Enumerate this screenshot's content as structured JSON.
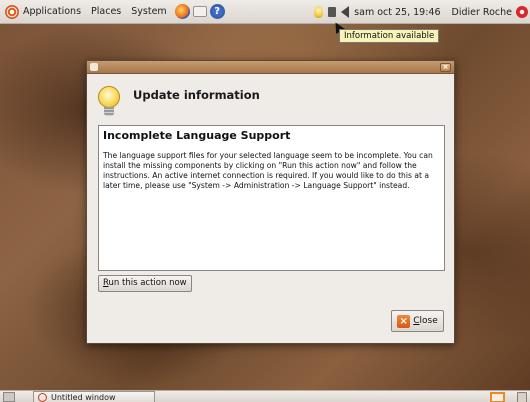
{
  "top_panel": {
    "menus": [
      {
        "label": "Applications"
      },
      {
        "label": "Places"
      },
      {
        "label": "System"
      }
    ],
    "clock": "sam oct 25, 19:46",
    "user": "Didier Roche"
  },
  "tooltip": {
    "text": "Information available"
  },
  "dialog": {
    "header_title": "Update information",
    "heading": "Incomplete Language Support",
    "body": "The language support files for your selected language seem to be incomplete. You can install the missing components by clicking on \"Run this action now\" and follow the instructions. An active internet connection is required. If you would like to do this at a later time, please use \"System -> Administration -> Language Support\" instead.",
    "action_button": {
      "mnemonic": "R",
      "rest": "un this action now"
    },
    "close_button": {
      "mnemonic": "C",
      "rest": "lose"
    }
  },
  "bottom_panel": {
    "task": "Untitled window"
  }
}
